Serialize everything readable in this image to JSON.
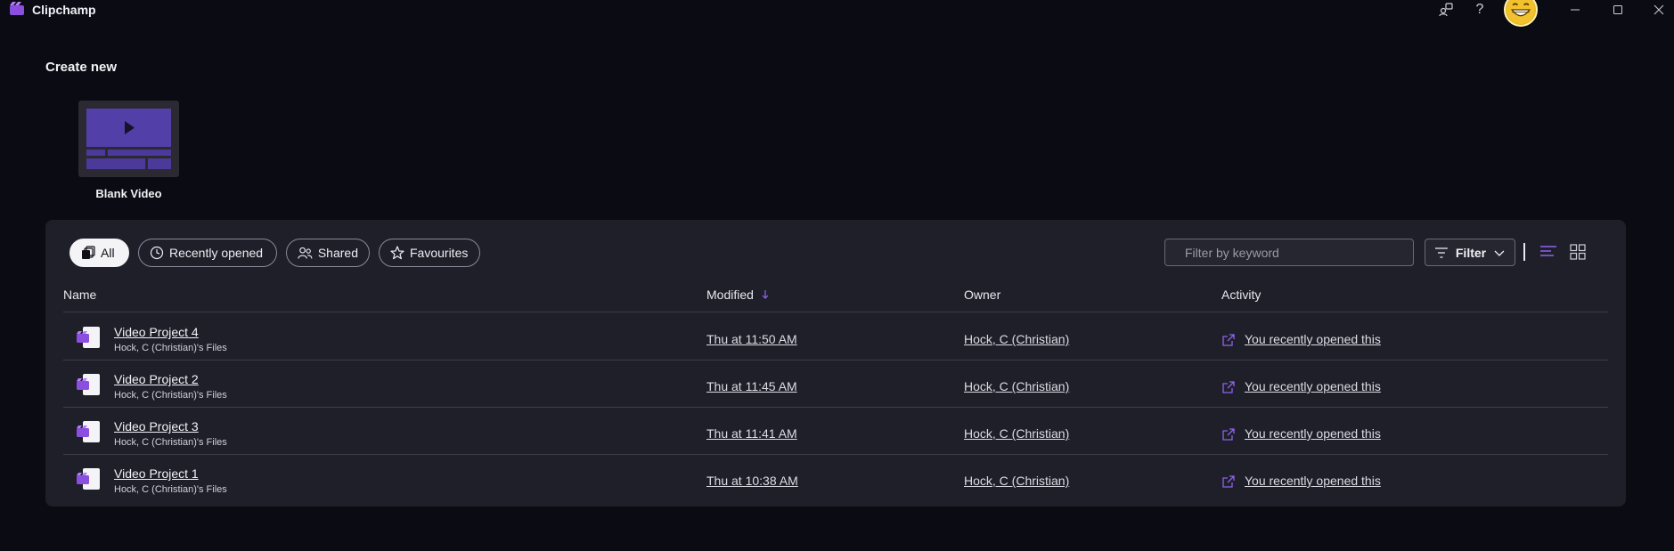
{
  "app": {
    "name": "Clipchamp",
    "accent": "#7d4bd8"
  },
  "titlebar": {
    "share_icon": "share-people-icon",
    "help_label": "?",
    "avatar_icon": "grinning-face-avatar",
    "min_icon": "minimize-icon",
    "max_icon": "maximize-icon",
    "close_icon": "close-icon"
  },
  "create_new": {
    "heading": "Create new",
    "templates": [
      {
        "label": "Blank Video",
        "icon": "video-timeline-thumbnail"
      }
    ]
  },
  "filters": {
    "chips": [
      {
        "label": "All",
        "icon": "stack-icon",
        "active": true
      },
      {
        "label": "Recently opened",
        "icon": "clock-icon",
        "active": false
      },
      {
        "label": "Shared",
        "icon": "people-icon",
        "active": false
      },
      {
        "label": "Favourites",
        "icon": "star-icon",
        "active": false
      }
    ],
    "search_placeholder": "Filter by keyword",
    "search_value": "",
    "filter_label": "Filter",
    "view_mode": "list"
  },
  "table": {
    "columns": {
      "name": "Name",
      "modified": "Modified",
      "owner": "Owner",
      "activity": "Activity"
    },
    "sort": {
      "column": "modified",
      "direction": "descending"
    },
    "rows": [
      {
        "title": "Video Project 4",
        "location": "Hock, C (Christian)'s Files",
        "modified": "Thu at 11:50 AM",
        "owner": "Hock, C (Christian)",
        "activity": "You recently opened this"
      },
      {
        "title": "Video Project 2",
        "location": "Hock, C (Christian)'s Files",
        "modified": "Thu at 11:45 AM",
        "owner": "Hock, C (Christian)",
        "activity": "You recently opened this"
      },
      {
        "title": "Video Project 3",
        "location": "Hock, C (Christian)'s Files",
        "modified": "Thu at 11:41 AM",
        "owner": "Hock, C (Christian)",
        "activity": "You recently opened this"
      },
      {
        "title": "Video Project 1",
        "location": "Hock, C (Christian)'s Files",
        "modified": "Thu at 10:38 AM",
        "owner": "Hock, C (Christian)",
        "activity": "You recently opened this"
      }
    ]
  }
}
